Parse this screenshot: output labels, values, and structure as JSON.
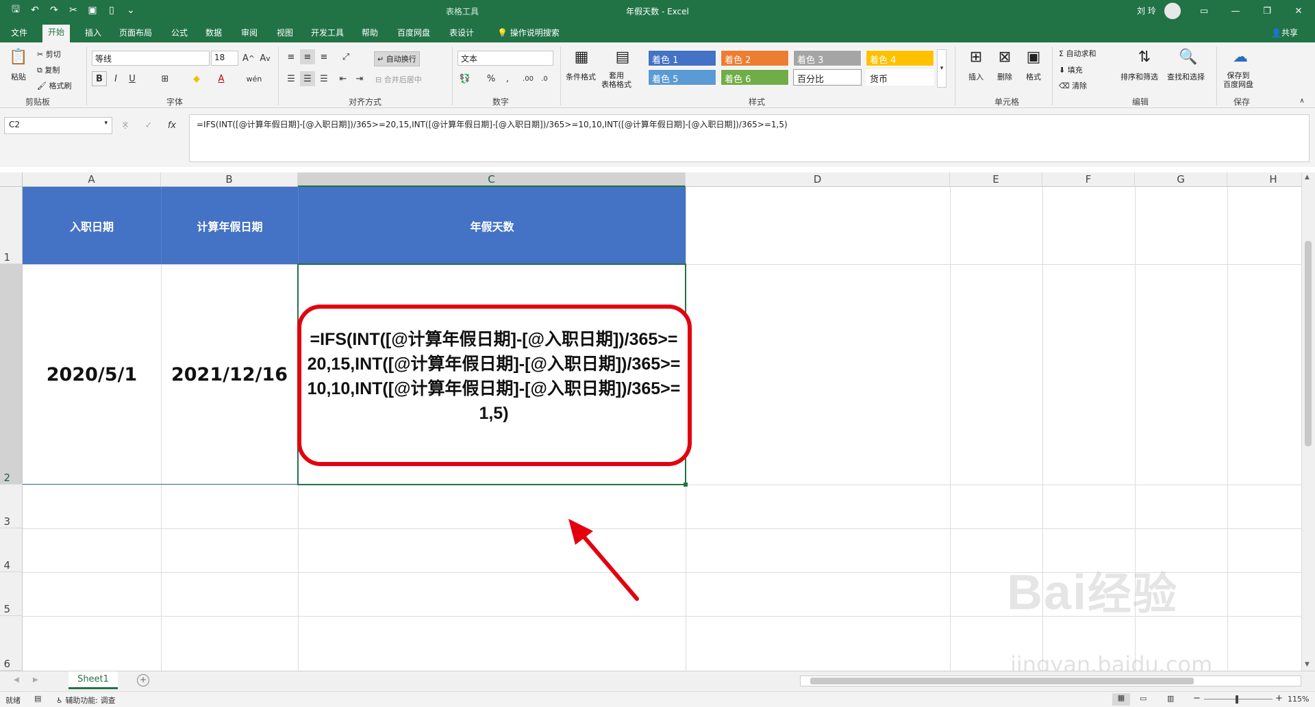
{
  "titlebar": {
    "context_tab": "表格工具",
    "title": "年假天数 - Excel",
    "user": "刘 玲"
  },
  "tabs": [
    "文件",
    "开始",
    "插入",
    "页面布局",
    "公式",
    "数据",
    "审阅",
    "视图",
    "开发工具",
    "帮助",
    "百度网盘",
    "表设计",
    "操作说明搜索"
  ],
  "share_label": "共享",
  "ribbon": {
    "clipboard": {
      "paste": "粘贴",
      "cut": "剪切",
      "copy": "复制",
      "format_painter": "格式刷",
      "label": "剪贴板"
    },
    "font": {
      "family": "等线",
      "size": "18",
      "label": "字体",
      "bold": "B",
      "italic": "I",
      "underline": "U",
      "font_color_glyph": "A"
    },
    "alignment": {
      "wrap": "自动换行",
      "merge": "合并后居中",
      "label": "对齐方式"
    },
    "number": {
      "format": "文本",
      "percent": "%",
      "comma": ",",
      "label": "数字"
    },
    "styles": {
      "conditional": "条件格式",
      "table_format": "套用\n表格格式",
      "cells": [
        {
          "label": "着色 1",
          "color": "#4472c4"
        },
        {
          "label": "着色 2",
          "color": "#ed7d31"
        },
        {
          "label": "着色 3",
          "color": "#a5a5a5"
        },
        {
          "label": "着色 4",
          "color": "#ffc000"
        },
        {
          "label": "着色 5",
          "color": "#5b9bd5"
        },
        {
          "label": "着色 6",
          "color": "#70ad47"
        },
        {
          "label": "百分比",
          "color": "#ffffff"
        },
        {
          "label": "货币",
          "color": "#ffffff"
        }
      ],
      "label": "样式"
    },
    "cells_group": {
      "insert": "插入",
      "delete": "删除",
      "format": "格式",
      "label": "单元格"
    },
    "editing": {
      "autosum": "自动求和",
      "fill": "填充",
      "clear": "清除",
      "sort": "排序和筛选",
      "find": "查找和选择",
      "label": "编辑"
    },
    "save": {
      "label_btn": "保存到\n百度网盘",
      "label": "保存"
    }
  },
  "formula_bar": {
    "name_box": "C2",
    "formula": "=IFS(INT([@计算年假日期]-[@入职日期])/365>=20,15,INT([@计算年假日期]-[@入职日期])/365>=10,10,INT([@计算年假日期]-[@入职日期])/365>=1,5)"
  },
  "grid": {
    "columns": [
      "A",
      "B",
      "C",
      "D",
      "E",
      "F",
      "G",
      "H"
    ],
    "rows": [
      "1",
      "2",
      "3",
      "4",
      "5",
      "6"
    ],
    "headers": [
      "入职日期",
      "计算年假日期",
      "年假天数"
    ],
    "row2": [
      "2020/5/1",
      "2021/12/16",
      "=IFS(INT([@计算年假日期]-[@入职日期])/365>=20,15,INT([@计算年假日期]-[@入职日期])/365>=10,10,INT([@计算年假日期]-[@入职日期])/365>=1,5)"
    ],
    "header_color": "#4472c4"
  },
  "annotation": {
    "color": "#e3000f"
  },
  "sheets": [
    "Sheet1"
  ],
  "status": {
    "mode": "就绪",
    "accessibility": "辅助功能: 调查",
    "zoom": "115%"
  },
  "watermark": {
    "brand": "Bai",
    "brand2": "经验",
    "url": "jingyan.baidu.com"
  }
}
